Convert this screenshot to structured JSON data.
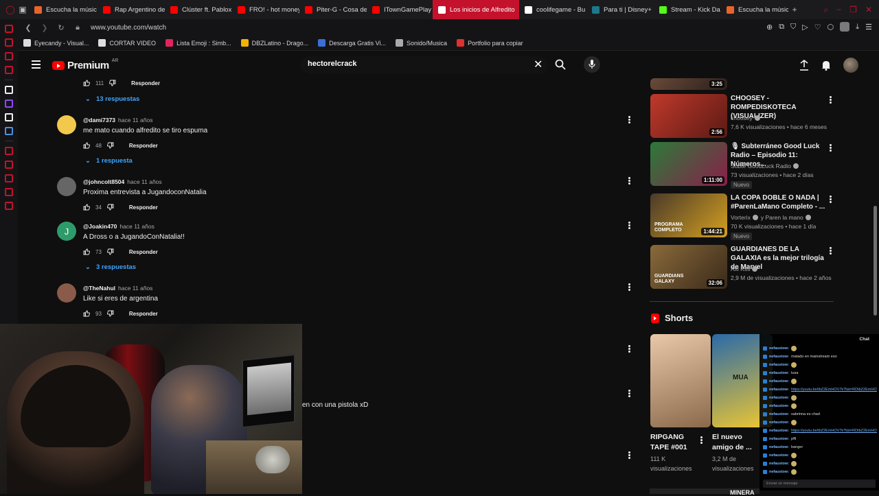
{
  "browser": {
    "tabs": [
      {
        "label": "Escucha la músic",
        "color": "#e8642a"
      },
      {
        "label": "Rap Argentino de",
        "color": "#ff0000"
      },
      {
        "label": "Clúster ft. Pablox",
        "color": "#ff0000"
      },
      {
        "label": "FRO! - hot money",
        "color": "#ff0000"
      },
      {
        "label": "Piter-G - Cosa de",
        "color": "#ff0000"
      },
      {
        "label": "ITownGamePlay",
        "color": "#ff0000"
      },
      {
        "label": "Los inicios de Alfredito",
        "color": "#ffffff",
        "active": true
      },
      {
        "label": "coolifegame - Bu",
        "color": "#ffffff"
      },
      {
        "label": "Para ti | Disney+",
        "color": "#1a7a8c"
      },
      {
        "label": "Stream - Kick Da",
        "color": "#53fc18"
      },
      {
        "label": "Escucha la músic",
        "color": "#e8642a"
      }
    ],
    "new_tab": "+",
    "url": "www.youtube.com/watch",
    "bookmarks": [
      {
        "label": "Eyecandy - Visual...",
        "color": "#dddddd"
      },
      {
        "label": "CORTAR VIDEO",
        "color": "#dddddd"
      },
      {
        "label": "Lista Emoji : Simb...",
        "color": "#e0245e"
      },
      {
        "label": "DBZLatino - Drago...",
        "color": "#f0b400"
      },
      {
        "label": "Descarga Gratis Vi...",
        "color": "#3b6fd6"
      },
      {
        "label": "Sonido/Musica",
        "color": "#aaaaaa"
      },
      {
        "label": "Portfolio para copiar",
        "color": "#e03030"
      }
    ]
  },
  "sidebar_icons": [
    {
      "name": "messenger-icon",
      "color": "#c4122c"
    },
    {
      "name": "bag-icon",
      "color": "#c4122c"
    },
    {
      "name": "chat-icon",
      "color": "#c4122c"
    },
    {
      "name": "mail-icon",
      "color": "#c4122c"
    },
    {
      "name": "sep",
      "color": ""
    },
    {
      "name": "aria-icon",
      "color": "#f1f1f1"
    },
    {
      "name": "twitch-icon",
      "color": "#9146ff"
    },
    {
      "name": "x-icon",
      "color": "#f1f1f1"
    },
    {
      "name": "translate-icon",
      "color": "#4a90e2"
    },
    {
      "name": "sep",
      "color": ""
    },
    {
      "name": "player-icon",
      "color": "#c4122c"
    },
    {
      "name": "wallet-icon",
      "color": "#c4122c"
    },
    {
      "name": "history-icon",
      "color": "#c4122c"
    },
    {
      "name": "download-icon",
      "color": "#c4122c"
    },
    {
      "name": "settings-icon",
      "color": "#c4122c"
    }
  ],
  "youtube": {
    "logo_text": "Premium",
    "country": "AR",
    "search_value": "hectorelcrack"
  },
  "comments": {
    "top_actions": {
      "likes": "111",
      "reply": "Responder"
    },
    "top_replies": "13 respuestas",
    "items": [
      {
        "author": "@dami7373",
        "time": "hace 11 años",
        "text": "me mato cuando alfredito se tiro espuma",
        "likes": "48",
        "reply": "Responder",
        "replies": "1 respuesta",
        "avatar_color": "#f2c94c"
      },
      {
        "author": "@johncolt8504",
        "time": "hace 11 años",
        "text": "Proxima entrevista a JugandoconNatalia",
        "likes": "34",
        "reply": "Responder",
        "replies": "",
        "avatar_color": "#666666"
      },
      {
        "author": "@Joakin470",
        "time": "hace 11 años",
        "text": "A Dross o a JugandoConNatalia!!",
        "likes": "73",
        "reply": "Responder",
        "replies": "3 respuestas",
        "avatar_color": "#2e9c6a",
        "initial": "J"
      },
      {
        "author": "@TheNahul",
        "time": "hace 11 años",
        "text": "Like si eres de argentina",
        "likes": "93",
        "reply": "Responder",
        "replies": "",
        "avatar_color": "#8a5a4a"
      }
    ],
    "partial_text": "en con una pistola xD"
  },
  "recommended": [
    {
      "title": "",
      "channel": "",
      "meta": "",
      "duration": "3:25",
      "badge": "",
      "colors": [
        "#6a4a3a",
        "#2a1f1a"
      ]
    },
    {
      "title": "CHOOSEY - ROMPEDISKOTECA (VISUALIZER)",
      "channel": "choosey",
      "meta": "7,6 K visualizaciones • hace 6 meses",
      "duration": "2:56",
      "badge": "",
      "colors": [
        "#c0392b",
        "#5b1a14"
      ]
    },
    {
      "title": "🎙 Subterráneo Good Luck Radio – Episodio 11: Números...",
      "channel": "Subte GoodLuck Radio",
      "meta": "73 visualizaciones • hace 2 días",
      "duration": "1:11:00",
      "badge": "Nuevo",
      "colors": [
        "#2b7a3a",
        "#8a1f4a"
      ]
    },
    {
      "title": "LA COPA DOBLE O NADA | #ParenLaMano Completo - ...",
      "channel": "Vorterix",
      "channel2": "y Paren la mano",
      "meta": "70 K visualizaciones • hace 1 día",
      "duration": "1:44:21",
      "badge": "Nuevo",
      "overlay": "PROGRAMA COMPLETO",
      "colors": [
        "#4a3a2a",
        "#d4a020"
      ]
    },
    {
      "title": "GUARDIANES DE LA GALAXIA es la mejor trilogía de Marvel",
      "channel": "Axl Kss",
      "meta": "2,9 M de visualizaciones • hace 2 años",
      "duration": "32:06",
      "badge": "",
      "overlay": "GUARDIANS GALAXY",
      "colors": [
        "#8a6a3a",
        "#3a2a1a"
      ]
    }
  ],
  "shorts": {
    "header": "Shorts",
    "items": [
      {
        "title": "RIPGANG TAPE #001",
        "meta": "111 K visualizaciones",
        "colors": [
          "#e8c8a8",
          "#8a6a4a"
        ]
      },
      {
        "title": "El nuevo amigo de ...",
        "meta": "3,2 M de visualizaciones",
        "colors": [
          "#2a6aa8",
          "#f0c830"
        ],
        "overlay": "MUA"
      }
    ],
    "next_title": "MINERA"
  },
  "chat": {
    "title": "Chat",
    "lines": [
      {
        "user": "nefaustow:",
        "text": "",
        "emote": true,
        "link": false
      },
      {
        "user": "nefaustow:",
        "text": "matado en mainstream eso",
        "emote": false,
        "link": false
      },
      {
        "user": "nefaustow:",
        "text": "",
        "emote": true,
        "link": false
      },
      {
        "user": "nefaustow:",
        "text": "tusa",
        "emote": false,
        "link": false
      },
      {
        "user": "nefaustow:",
        "text": "",
        "emote": true,
        "link": false
      },
      {
        "user": "nefaustow:",
        "text": "https://youtu.be/tbZ2EmHOV7k?list=RDtbZ2EmHOV7k",
        "emote": false,
        "link": true
      },
      {
        "user": "nefaustow:",
        "text": "",
        "emote": true,
        "link": false
      },
      {
        "user": "nefaustow:",
        "text": "",
        "emote": true,
        "link": false
      },
      {
        "user": "nefaustow:",
        "text": "sabrinna es chad",
        "emote": false,
        "link": false
      },
      {
        "user": "nefaustow:",
        "text": "",
        "emote": true,
        "link": false
      },
      {
        "user": "nefaustow:",
        "text": "https://youtu.be/tbZ2EmHOV7k?list=RDtbZ2EmHOV7k",
        "emote": false,
        "link": true
      },
      {
        "user": "nefaustow:",
        "text": "pffi",
        "emote": false,
        "link": false
      },
      {
        "user": "nefaustow:",
        "text": "banger",
        "emote": false,
        "link": false
      },
      {
        "user": "nefaustow:",
        "text": "",
        "emote": true,
        "link": false
      },
      {
        "user": "nefaustow:",
        "text": "",
        "emote": true,
        "link": false
      },
      {
        "user": "nefaustow:",
        "text": "",
        "emote": true,
        "link": false
      }
    ],
    "input_placeholder": "Enviar un mensaje"
  }
}
